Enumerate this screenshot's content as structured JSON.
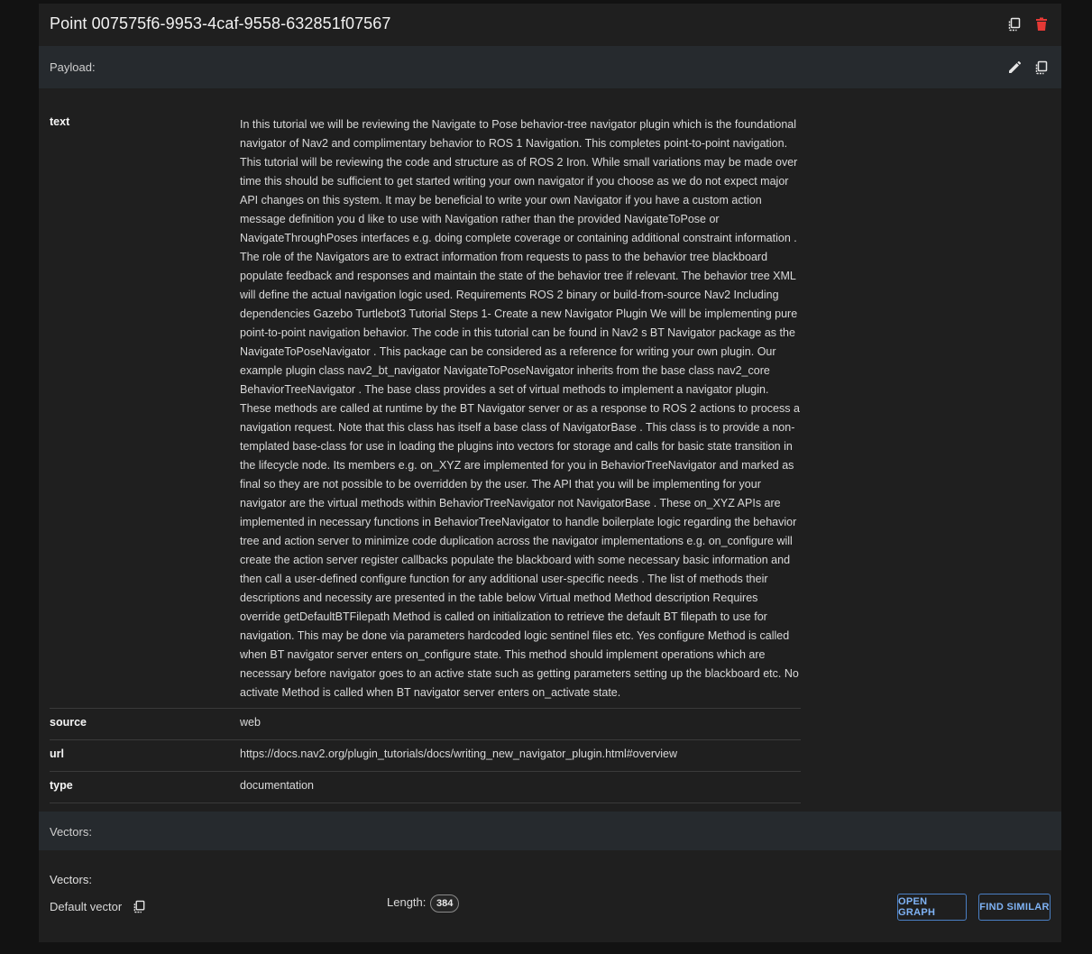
{
  "header": {
    "title": "Point 007575f6-9953-4caf-9558-632851f07567",
    "copy_icon": "copy-icon",
    "delete_icon": "trash-icon",
    "delete_color": "#e53935"
  },
  "payload_section": {
    "label": "Payload:",
    "edit_icon": "pencil-icon",
    "copy_icon": "copy-icon"
  },
  "payload": [
    {
      "key": "text",
      "value": "In this tutorial we will be reviewing the Navigate to Pose behavior-tree navigator plugin which is the foundational navigator of Nav2 and complimentary behavior to ROS 1 Navigation. This completes point-to-point navigation. This tutorial will be reviewing the code and structure as of ROS 2 Iron. While small variations may be made over time this should be sufficient to get started writing your own navigator if you choose as we do not expect major API changes on this system. It may be beneficial to write your own Navigator if you have a custom action message definition you d like to use with Navigation rather than the provided NavigateToPose or NavigateThroughPoses interfaces e.g. doing complete coverage or containing additional constraint information . The role of the Navigators are to extract information from requests to pass to the behavior tree blackboard populate feedback and responses and maintain the state of the behavior tree if relevant. The behavior tree XML will define the actual navigation logic used. Requirements ROS 2 binary or build-from-source Nav2 Including dependencies Gazebo Turtlebot3 Tutorial Steps 1- Create a new Navigator Plugin We will be implementing pure point-to-point navigation behavior. The code in this tutorial can be found in Nav2 s BT Navigator package as the NavigateToPoseNavigator . This package can be considered as a reference for writing your own plugin. Our example plugin class nav2_bt_navigator NavigateToPoseNavigator inherits from the base class nav2_core BehaviorTreeNavigator . The base class provides a set of virtual methods to implement a navigator plugin. These methods are called at runtime by the BT Navigator server or as a response to ROS 2 actions to process a navigation request. Note that this class has itself a base class of NavigatorBase . This class is to provide a non-templated base-class for use in loading the plugins into vectors for storage and calls for basic state transition in the lifecycle node. Its members e.g. on_XYZ are implemented for you in BehaviorTreeNavigator and marked as final so they are not possible to be overridden by the user. The API that you will be implementing for your navigator are the virtual methods within BehaviorTreeNavigator not NavigatorBase . These on_XYZ APIs are implemented in necessary functions in BehaviorTreeNavigator to handle boilerplate logic regarding the behavior tree and action server to minimize code duplication across the navigator implementations e.g. on_configure will create the action server register callbacks populate the blackboard with some necessary basic information and then call a user-defined configure function for any additional user-specific needs . The list of methods their descriptions and necessity are presented in the table below Virtual method Method description Requires override getDefaultBTFilepath Method is called on initialization to retrieve the default BT filepath to use for navigation. This may be done via parameters hardcoded logic sentinel files etc. Yes configure Method is called when BT navigator server enters on_configure state. This method should implement operations which are necessary before navigator goes to an active state such as getting parameters setting up the blackboard etc. No activate Method is called when BT navigator server enters on_activate state."
    },
    {
      "key": "source",
      "value": "web"
    },
    {
      "key": "url",
      "value": "https://docs.nav2.org/plugin_tutorials/docs/writing_new_navigator_plugin.html#overview"
    },
    {
      "key": "type",
      "value": "documentation"
    }
  ],
  "vectors_section": {
    "label": "Vectors:"
  },
  "vectors": {
    "heading": "Vectors:",
    "name": "Default vector",
    "copy_icon": "copy-icon",
    "length_label": "Length:",
    "length_value": "384",
    "open_graph_label": "OPEN GRAPH",
    "find_similar_label": "FIND SIMILAR"
  },
  "colors": {
    "background": "#121212",
    "card": "#1f1f1f",
    "section_bar": "#262a2e",
    "accent": "#7fb3f5"
  }
}
